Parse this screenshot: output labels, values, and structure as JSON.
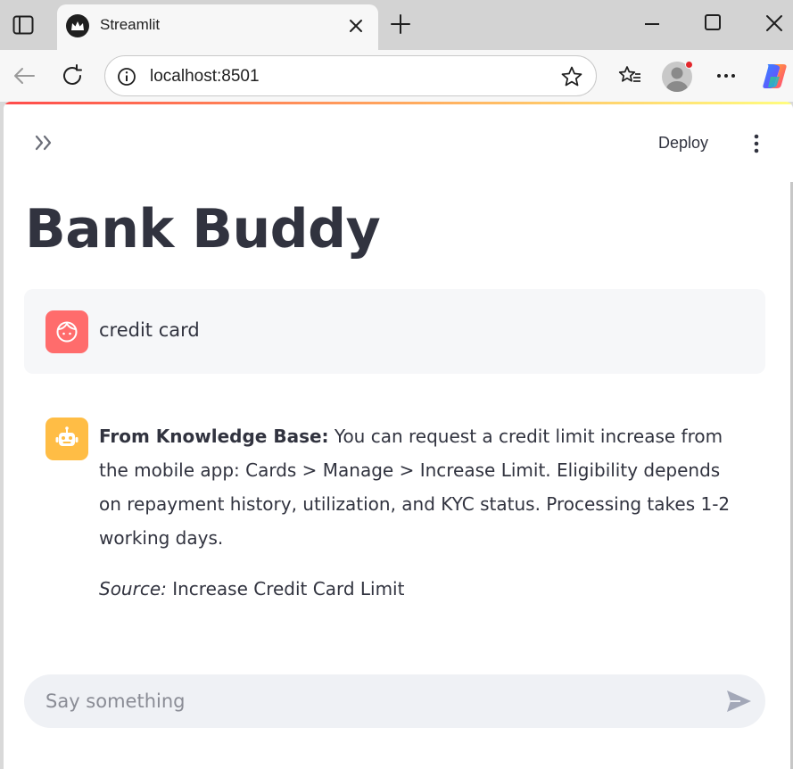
{
  "browser": {
    "tab_title": "Streamlit",
    "url": "localhost:8501"
  },
  "app": {
    "deploy_label": "Deploy",
    "title": "Bank Buddy"
  },
  "messages": {
    "user_text": "credit card",
    "bot_kb_label": "From Knowledge Base:",
    "bot_text": " You can request a credit limit increase from the mobile app: Cards > Manage > Increase Limit. Eligibility depends on repayment history, utilization, and KYC status. Processing takes 1-2 working days.",
    "source_label": "Source:",
    "source_value": " Increase Credit Card Limit"
  },
  "chat_input": {
    "placeholder": "Say something"
  },
  "colors": {
    "user_avatar": "#ff6c6c",
    "bot_avatar": "#ffbd45",
    "text": "#31333f",
    "notification_dot": "#e3262b"
  },
  "icons": [
    "tab-sidebar-icon",
    "streamlit-favicon",
    "close-icon",
    "plus-icon",
    "minimize-icon",
    "maximize-icon",
    "window-close-icon",
    "back-arrow-icon",
    "reload-icon",
    "info-icon",
    "star-icon",
    "favorites-icon",
    "profile-avatar",
    "more-icon",
    "copilot-icon",
    "chevron-double-right-icon",
    "kebab-menu-icon",
    "user-face-icon",
    "robot-icon",
    "send-icon"
  ]
}
